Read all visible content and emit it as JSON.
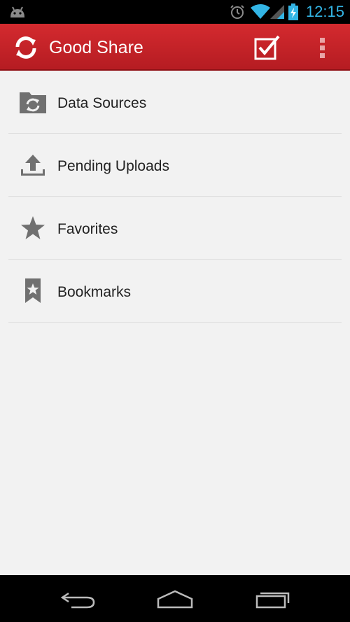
{
  "status_bar": {
    "time": "12:15",
    "icons": [
      "android-icon",
      "alarm-icon",
      "wifi-icon",
      "signal-icon",
      "battery-charging-icon"
    ],
    "accent_color": "#33b5e5"
  },
  "action_bar": {
    "title": "Good Share",
    "background_color": "#c9252b",
    "actions": [
      "select-checkbox-icon",
      "overflow-menu-icon"
    ]
  },
  "menu": {
    "items": [
      {
        "label": "Data Sources",
        "icon": "sync-folder-icon"
      },
      {
        "label": "Pending Uploads",
        "icon": "upload-icon"
      },
      {
        "label": "Favorites",
        "icon": "star-icon"
      },
      {
        "label": "Bookmarks",
        "icon": "bookmark-icon"
      }
    ]
  },
  "nav_bar": {
    "buttons": [
      "back-icon",
      "home-icon",
      "recents-icon"
    ]
  }
}
